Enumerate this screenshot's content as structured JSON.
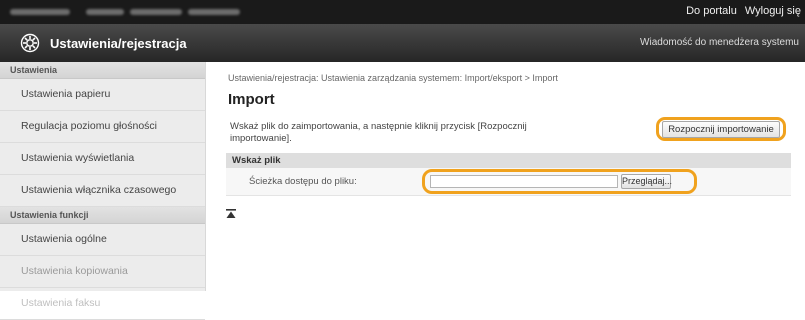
{
  "header": {
    "portal_link": "Do portalu",
    "logout_link": "Wyloguj się",
    "title": "Ustawienia/rejestracja",
    "message_link": "Wiadomość do menedżera systemu",
    "icon": "gear-icon"
  },
  "sidebar": {
    "sections": [
      {
        "title": "Ustawienia",
        "items": [
          {
            "label": "Ustawienia papieru"
          },
          {
            "label": "Regulacja poziomu głośności"
          },
          {
            "label": "Ustawienia wyświetlania"
          },
          {
            "label": "Ustawienia włącznika czasowego"
          }
        ]
      },
      {
        "title": "Ustawienia funkcji",
        "items": [
          {
            "label": "Ustawienia ogólne"
          },
          {
            "label": "Ustawienia kopiowania"
          },
          {
            "label": "Ustawienia faksu"
          }
        ]
      }
    ]
  },
  "main": {
    "breadcrumb": "Ustawienia/rejestracja: Ustawienia zarządzania systemem: Import/eksport > Import",
    "title": "Import",
    "description": "Wskaż plik do zaimportowania, a następnie kliknij przycisk [Rozpocznij importowanie].",
    "start_button": "Rozpocznij importowanie",
    "section_title": "Wskaż plik",
    "file_path_label": "Ścieżka dostępu do pliku:",
    "file_path_value": "",
    "browse_button": "Przeglądaj...",
    "back_to_top_icon": "arrow-up-to-top-icon"
  },
  "colors": {
    "highlight": "#f0a21e",
    "topbar": "#1a1a1a",
    "titlebar": "#333333",
    "sidebar": "#ececec"
  }
}
